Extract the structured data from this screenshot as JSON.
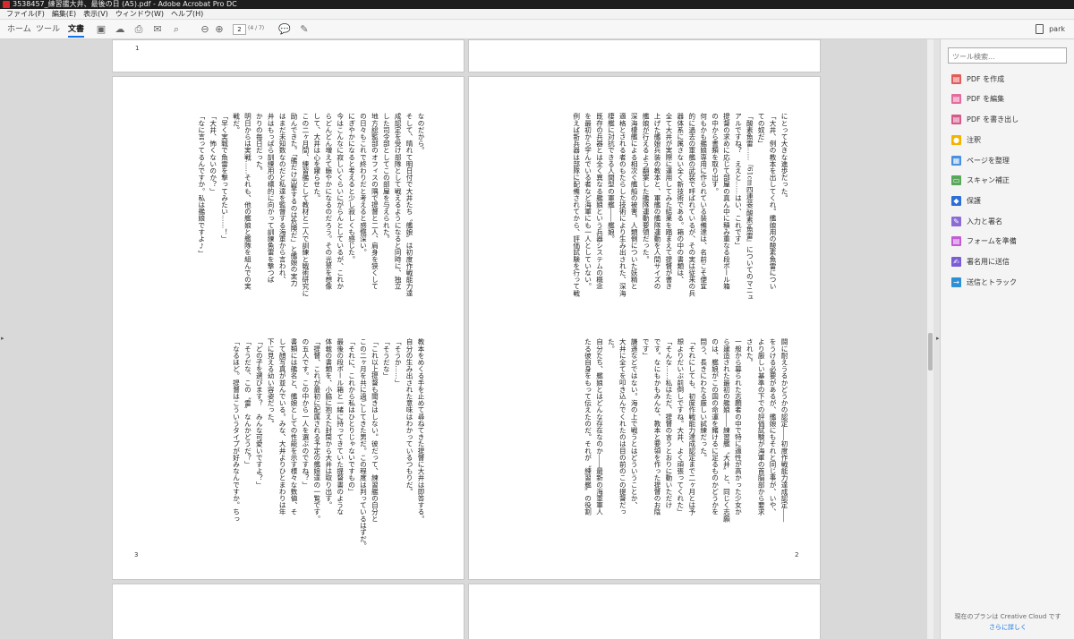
{
  "window": {
    "title": "3538457_練習艦大井、最後の日 (A5).pdf - Adobe Acrobat Pro DC"
  },
  "menu": [
    "ファイル(F)",
    "編集(E)",
    "表示(V)",
    "ウィンドウ(W)",
    "ヘルプ(H)"
  ],
  "tabs": {
    "home": "ホーム",
    "tools": "ツール",
    "document": "文書"
  },
  "nav": {
    "page_value": "2",
    "page_total": "(4 / 7)"
  },
  "user": {
    "name": "park"
  },
  "side_panel": {
    "search_placeholder": "ツール検索...",
    "items": [
      {
        "label": "PDF を作成",
        "icon": "create-pdf-icon",
        "color": "#e45b5b"
      },
      {
        "label": "PDF を編集",
        "icon": "edit-pdf-icon",
        "color": "#e36b9e"
      },
      {
        "label": "PDF を書き出し",
        "icon": "export-pdf-icon",
        "color": "#d55a8a"
      },
      {
        "label": "注釈",
        "icon": "comment-icon",
        "color": "#f3b400"
      },
      {
        "label": "ページを整理",
        "icon": "organize-pages-icon",
        "color": "#4a90e2"
      },
      {
        "label": "スキャン補正",
        "icon": "scan-icon",
        "color": "#5aa65a"
      },
      {
        "label": "保護",
        "icon": "shield-icon",
        "color": "#2d6fd6"
      },
      {
        "label": "入力と署名",
        "icon": "fill-sign-icon",
        "color": "#8b6bd6"
      },
      {
        "label": "フォームを準備",
        "icon": "form-icon",
        "color": "#c45bd6"
      },
      {
        "label": "署名用に送信",
        "icon": "send-sign-icon",
        "color": "#7a5cd6"
      },
      {
        "label": "送信とトラック",
        "icon": "send-track-icon",
        "color": "#2d8fd6"
      }
    ],
    "cc_note": "現在のプランは Creative Cloud です",
    "cc_link": "さらに詳しく"
  },
  "pages": {
    "top_left_number": "1",
    "left_number": "3",
    "right_number": "2",
    "right_top": "にとって大きな進歩だった。\n「大井、例の教本を出してくれ。艦娘用の酸素魚雷につい\nての奴だ」\n「酸素魚雷……『61cm四連装(酸素)魚雷』についてのマニュ\nアルですね？　ええと……はい、これです」\n提督の求めに応じて部屋の真ん中に積み重なる段ボール箱\nの中から書類を取り出す。\n何もかも艦娘専用に作られている装備達は、名前こそ便宜\n的に過去の軍艦の武装で呼ばれているが、その実は従来の兵\n器体系に属さない全く新技術である。箱の中の書類は、\n全て大井が実際に運用してみた結果を踏まえて提督が書き\n上げた艦娘兵装の教本と、軍艦の艦隊運動を人間サイズの\n艦娘が行えるよう翻案した艦隊運動要領だった。\n深海棲艦による相次ぐ艦船の被害。人類側についた妖精と\n適格とされる者のもたらした技術により生み出された、深海\n棲艦に対抗できる人間型の軍艦――艦娘。\n既存の兵器とは全く異なる艦娘という兵器システムの概念\nを最初から学んでいる者など海軍にも一人としていない。\n例えば新兵器は部隊に配備されてから、評価試験を行って戦",
    "right_bottom": "闘に耐えうるかどうかの認定――初度作戦能力達成認定――\nをうける必要があるが、艦娘にもそれと同じ事が、いや、\nより厳しい基準の下での評価試験が海軍の首脳部から要求\nされた。\n一般から募られた志願者の中で特に適性が高かった少女か\nら建造された最初の艦娘――練習艦〝大井〟と、同じく志願\nのは、艦娘がこの国の命運を賭けるに足るものかどうかを\n問う、長きにわたる厳しい試練だった。\n「それにしても、初度作戦能力達成認定まで二ヶ月とは予\n想よりだいぶ前倒しですね。大井、よく頑張ってくれた」\n「そんな……私はただ、提督の言うとおりに動いただけ\nです。なにもかもみんな、教本と要領を作った提督のお陰\nです」\n謙遜などではない。海の上で戦うとはどういうことか、\n大井に全てを叩き込んでくれたのは目の前のこの提督だっ\nた。\n自分たち、艦娘とはどんな存在なのか――最新の海軍軍人\nたる彼自身をもって伝えたのだ。それが〝練習艦〟の役割",
    "left_top": "なのだから。\nそして、晴れて明日付で大井たち〝艦娘〟は初度作戦能力達\n成認定を受け部隊として戦えるようになると同時に、独立\nした司令部としてこの部屋を与えられた。\n地方総監部のオフィスの隅で提督と二人、肩身を狭くして\nの日々もこれで終わりだと考えると感慨深い。\nにぎやかになると考えると少し寂しくも感じた。\n今はこんなに寂しいくらいにがらんとしているが、これか\nらどんどん増えて賑やかになるのだろう。その光景を想像\nして、大井は心を躍らせた。\nこの二ヶ月間、練習艦として教材と二人で訓練と戦術研究に\n励んできた。「艦だけ出撃するのは危険だ」と艦娘の実力\nはまだ未知数なのだと私達を監督する海軍から言われ、\n井はもっぱら訓練用の標的に向かって訓練魚雷を撃つば\nかりの毎日だった。\n明日からは実戦……それも、他の艦娘と艦隊を組んでの実\n戦だ。\n「早く実戦で魚雷を撃ってみたい……！」\n「大井、怖くないのか？」\n「なに言ってるんですか。私は艦娘ですよ♪」",
    "left_bottom": "教本をめくる手を止めて尋ねてきた提督に大井は即答する。\n自分の生み出された意味はわかっているつもりだ。\n「そうか……」\n「そうだな」\n「これ以上提督も聞きはしない。彼だって、練習艦の自分と\nこの二ヶ月を共に過ごしてきた男だ。この程度は判っているはずだ。\n「それに、これから私はひとりじゃないですもの」\n最後の段ボール箱と一緒に持ってきていた提督書のような\n体裁の書類を、小脇に抱えた封筒から大井は取り出す。\n「提督、これが最初に配属される予定の艦娘達の一覧です。\nの五人です。この中から一人を選ぶのですね？」\n書類には艦名と、艦娘としての性能を示す様々な数値、そ\nして顔写真が並んでいる。みな、大井よりひとまわりは年\n下に見える幼い容姿だった。\n「どの子を選びます？　みんな可愛いですよ？」\n「そうだな、この〝雷〟なんかどうだ？」\n「なるほど。提督はこういうタイプが好みなんですか。ちっ"
  }
}
